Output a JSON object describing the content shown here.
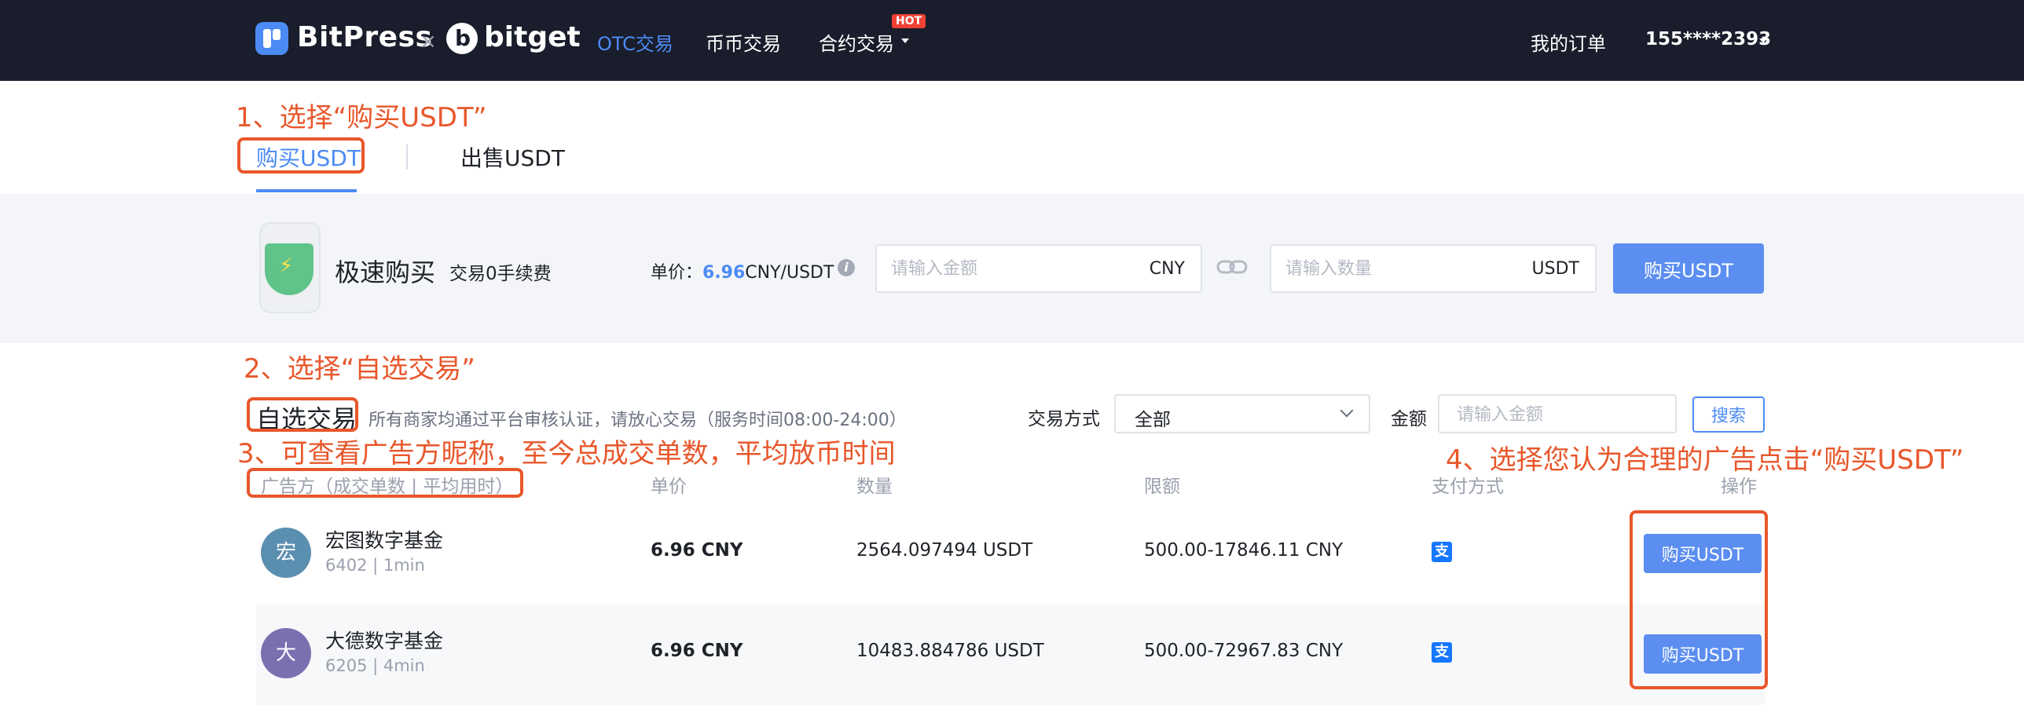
{
  "nav": {
    "brand1": "BitPress",
    "separator": "×",
    "brand2": "bitget",
    "items": [
      "OTC交易",
      "币币交易",
      "合约交易"
    ],
    "hot_badge": "HOT",
    "my_orders": "我的订单",
    "account": "155****2393",
    "colors": {
      "background": "#1a1d2b",
      "accent": "#4c8bf5",
      "hot": "#f04134"
    }
  },
  "annotations": {
    "step1": "1、选择“购买USDT”",
    "step2": "2、选择“自选交易”",
    "step3": "3、可查看广告方昵称，至今总成交单数，平均放币时间",
    "step4": "4、选择您认为合理的广告点击“购买USDT”",
    "color": "#e8572b"
  },
  "tabs": {
    "buy": "购买USDT",
    "sell": "出售USDT"
  },
  "quick_buy": {
    "title": "极速购买",
    "fee_note": "交易0手续费",
    "price_label": "单价：",
    "price_value": "6.96",
    "price_unit": "CNY/USDT",
    "amount_placeholder": "请输入金额",
    "amount_unit": "CNY",
    "quantity_placeholder": "请输入数量",
    "quantity_unit": "USDT",
    "button": "购买USDT",
    "icon": "shield-icon"
  },
  "self_select": {
    "title": "自选交易",
    "description": "所有商家均通过平台审核认证，请放心交易（服务时间08:00-24:00）",
    "method_label": "交易方式",
    "method_value": "全部",
    "amount_label": "金额",
    "amount_placeholder": "请输入金额",
    "search_button": "搜索"
  },
  "table": {
    "headers": [
      "广告方（成交单数 | 平均用时）",
      "单价",
      "数量",
      "限额",
      "支付方式",
      "操作"
    ],
    "rows": [
      {
        "avatar": "宏",
        "avatar_color": "#5b8fb0",
        "name": "宏图数字基金",
        "stats": "6402 | 1min",
        "price": "6.96 CNY",
        "quantity": "2564.097494 USDT",
        "limit": "500.00-17846.11 CNY",
        "payment": "alipay-icon",
        "payment_glyph": "支",
        "action": "购买USDT"
      },
      {
        "avatar": "大",
        "avatar_color": "#7b6fb0",
        "name": "大德数字基金",
        "stats": "6205 | 4min",
        "price": "6.96 CNY",
        "quantity": "10483.884786 USDT",
        "limit": "500.00-72967.83 CNY",
        "payment": "alipay-icon",
        "payment_glyph": "支",
        "action": "购买USDT"
      }
    ]
  }
}
